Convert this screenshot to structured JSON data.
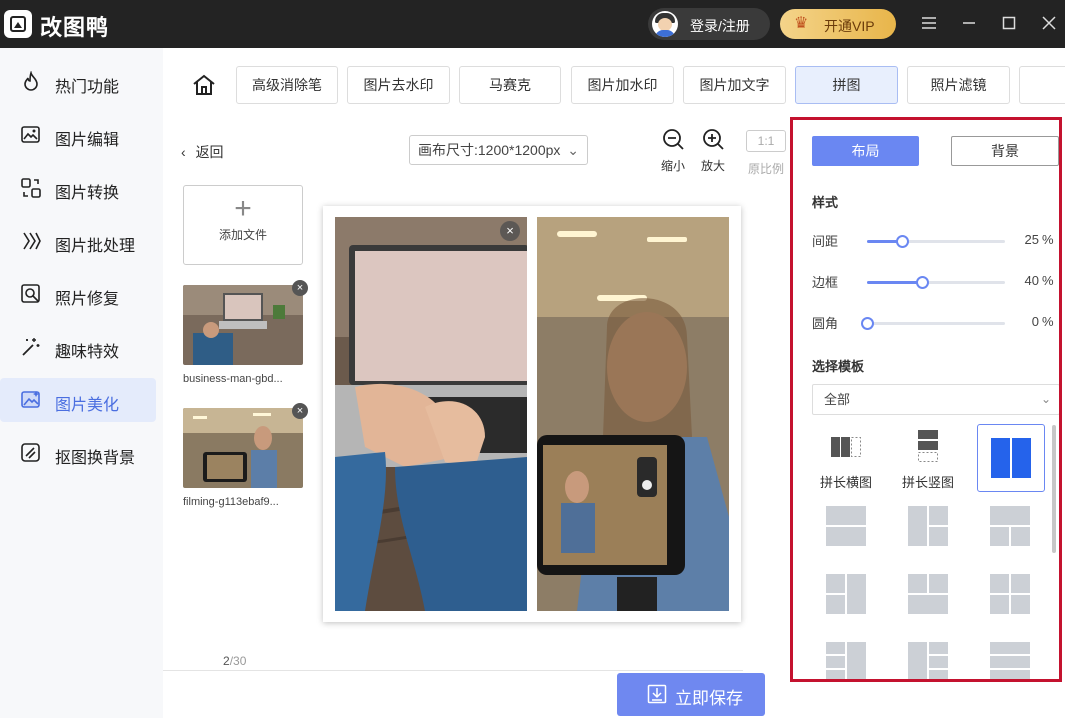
{
  "app": {
    "title": "改图鸭"
  },
  "header": {
    "login_label": "登录/注册",
    "vip_label": "开通VIP",
    "controls": [
      "menu-icon",
      "minimize-icon",
      "maximize-icon",
      "close-icon"
    ]
  },
  "sidebar": {
    "items": [
      {
        "label": "热门功能",
        "icon": "fire-icon",
        "active": false
      },
      {
        "label": "图片编辑",
        "icon": "image-edit-icon",
        "active": false
      },
      {
        "label": "图片转换",
        "icon": "convert-icon",
        "active": false
      },
      {
        "label": "图片批处理",
        "icon": "batch-icon",
        "active": false
      },
      {
        "label": "照片修复",
        "icon": "repair-icon",
        "active": false
      },
      {
        "label": "趣味特效",
        "icon": "magic-wand-icon",
        "active": false
      },
      {
        "label": "图片美化",
        "icon": "beautify-icon",
        "active": true
      },
      {
        "label": "抠图换背景",
        "icon": "cutout-icon",
        "active": false
      }
    ]
  },
  "toolbar": {
    "tabs": [
      {
        "label": "高级消除笔",
        "active": false
      },
      {
        "label": "图片去水印",
        "active": false
      },
      {
        "label": "马赛克",
        "active": false
      },
      {
        "label": "图片加水印",
        "active": false
      },
      {
        "label": "图片加文字",
        "active": false
      },
      {
        "label": "拼图",
        "active": true
      },
      {
        "label": "照片滤镜",
        "active": false
      }
    ]
  },
  "workspace": {
    "back_label": "返回",
    "canvas_size_label": "画布尺寸:1200*1200px",
    "zoom_out_label": "缩小",
    "zoom_in_label": "放大",
    "ratio_box_label": "1:1",
    "ratio_label": "原比例",
    "add_file_label": "添加文件",
    "files": [
      {
        "name": "business-man-gbd..."
      },
      {
        "name": "filming-g113ebaf9..."
      }
    ],
    "page_current": "2",
    "page_total": "/30",
    "save_label": "立即保存"
  },
  "panel": {
    "tab_layout": "布局",
    "tab_background": "背景",
    "style_title": "样式",
    "sliders": [
      {
        "label": "间距",
        "value": 25,
        "unit": "%"
      },
      {
        "label": "边框",
        "value": 40,
        "unit": "%"
      },
      {
        "label": "圆角",
        "value": 0,
        "unit": "%"
      }
    ],
    "template_title": "选择模板",
    "template_filter": "全部",
    "templates": [
      {
        "label": "拼长横图"
      },
      {
        "label": "拼长竖图"
      }
    ]
  },
  "colors": {
    "accent": "#6a87f2",
    "titlebar": "#232323",
    "highlight_border": "#c4122f",
    "vip": "#e8b54a"
  }
}
